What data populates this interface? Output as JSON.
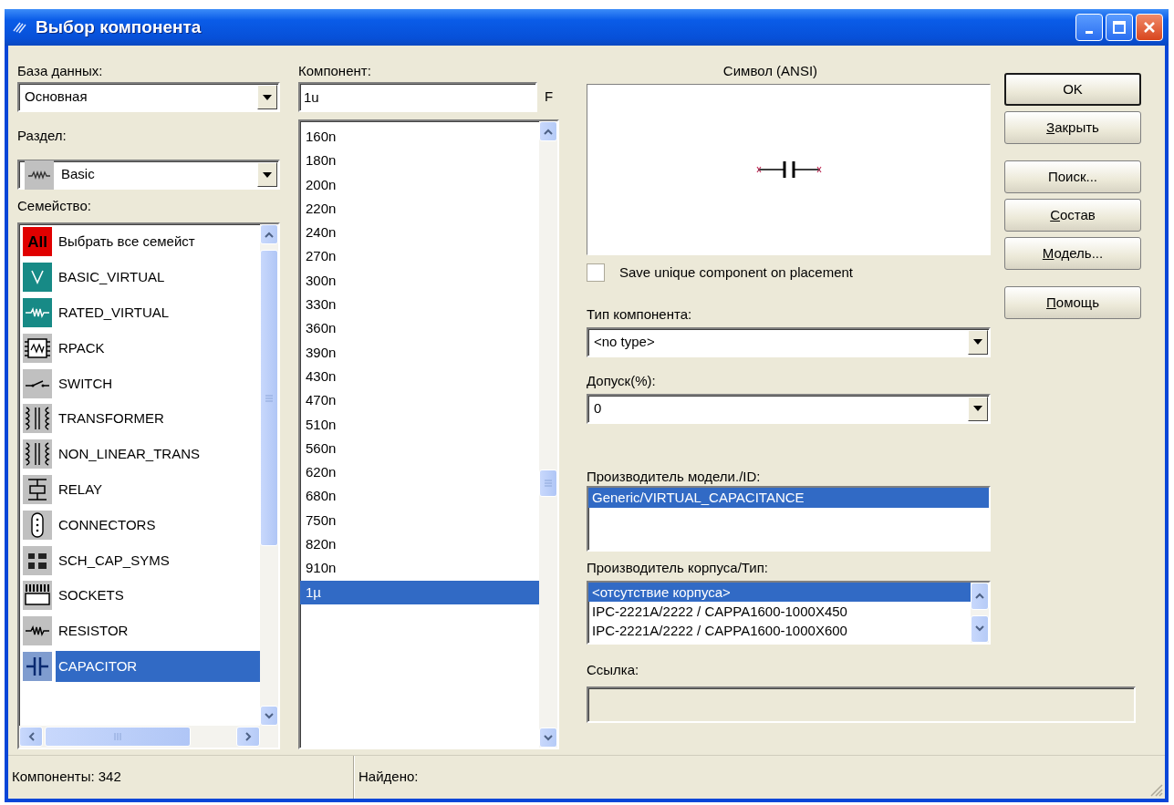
{
  "window": {
    "title": "Выбор компонента"
  },
  "database": {
    "label": "База данных:",
    "value": "Основная"
  },
  "group": {
    "label": "Раздел:",
    "value": "Basic"
  },
  "family": {
    "label": "Семейство:",
    "items": [
      {
        "name": "Выбрать все семейст",
        "tag": "All",
        "selected": false
      },
      {
        "name": "BASIC_VIRTUAL",
        "selected": false
      },
      {
        "name": "RATED_VIRTUAL",
        "selected": false
      },
      {
        "name": "RPACK",
        "selected": false
      },
      {
        "name": "SWITCH",
        "selected": false
      },
      {
        "name": "TRANSFORMER",
        "selected": false
      },
      {
        "name": "NON_LINEAR_TRANS",
        "selected": false
      },
      {
        "name": "RELAY",
        "selected": false
      },
      {
        "name": "CONNECTORS",
        "selected": false
      },
      {
        "name": "SCH_CAP_SYMS",
        "selected": false
      },
      {
        "name": "SOCKETS",
        "selected": false
      },
      {
        "name": "RESISTOR",
        "selected": false
      },
      {
        "name": "CAPACITOR",
        "selected": true
      }
    ]
  },
  "component": {
    "label": "Компонент:",
    "value": "1u",
    "unit": "F",
    "items": [
      {
        "value": "160n",
        "selected": false
      },
      {
        "value": "180n",
        "selected": false
      },
      {
        "value": "200n",
        "selected": false
      },
      {
        "value": "220n",
        "selected": false
      },
      {
        "value": "240n",
        "selected": false
      },
      {
        "value": "270n",
        "selected": false
      },
      {
        "value": "300n",
        "selected": false
      },
      {
        "value": "330n",
        "selected": false
      },
      {
        "value": "360n",
        "selected": false
      },
      {
        "value": "390n",
        "selected": false
      },
      {
        "value": "430n",
        "selected": false
      },
      {
        "value": "470n",
        "selected": false
      },
      {
        "value": "510n",
        "selected": false
      },
      {
        "value": "560n",
        "selected": false
      },
      {
        "value": "620n",
        "selected": false
      },
      {
        "value": "680n",
        "selected": false
      },
      {
        "value": "750n",
        "selected": false
      },
      {
        "value": "820n",
        "selected": false
      },
      {
        "value": "910n",
        "selected": false
      },
      {
        "value": "1µ",
        "selected": true
      }
    ]
  },
  "symbol": {
    "title": "Символ (ANSI)"
  },
  "save_unique": {
    "label": "Save unique component on placement",
    "checked": false
  },
  "component_type": {
    "label": "Тип компонента:",
    "value": "<no type>"
  },
  "tolerance": {
    "label": "Допуск(%):",
    "value": "0"
  },
  "model_manufacturer": {
    "label": "Производитель модели./ID:",
    "items": [
      {
        "text": "Generic/VIRTUAL_CAPACITANCE",
        "selected": true
      }
    ]
  },
  "footprint_manufacturer": {
    "label": "Производитель корпуса/Тип:",
    "items": [
      {
        "text": "<отсутствие корпуса>",
        "selected": true
      },
      {
        "text": "IPC-2221A/2222 / CAPPA1600-1000X450",
        "selected": false
      },
      {
        "text": "IPC-2221A/2222 / CAPPA1600-1000X600",
        "selected": false
      }
    ]
  },
  "hyperlink": {
    "label": "Ссылка:"
  },
  "buttons": [
    {
      "label": "OK",
      "default": true,
      "mnemonic": false
    },
    {
      "label": "Закрыть",
      "default": false,
      "mnemonic": true
    },
    {
      "label": "Поиск...",
      "default": false,
      "mnemonic": false
    },
    {
      "label": "Состав",
      "default": false,
      "mnemonic": true
    },
    {
      "label": "Модель...",
      "default": false,
      "mnemonic": true
    },
    {
      "label": "Помощь",
      "default": false,
      "mnemonic": true
    }
  ],
  "status_bar": {
    "components": "Компоненты: 342",
    "found": "Найдено:"
  }
}
